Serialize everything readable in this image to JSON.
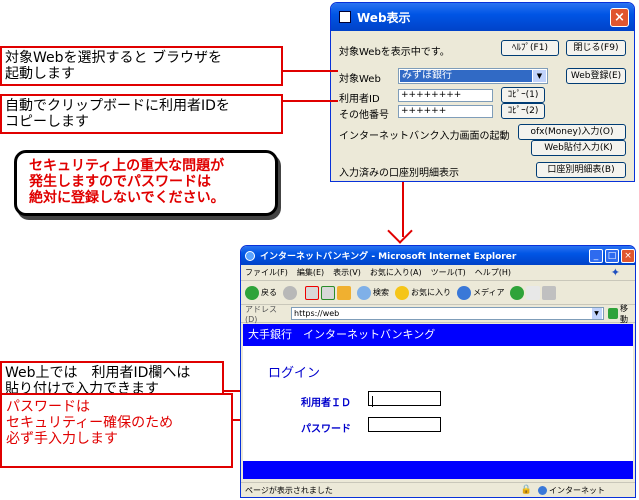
{
  "dialog": {
    "title": "Web表示",
    "close": "×",
    "status_text": "対象Webを表示中です。",
    "help_btn": "ﾍﾙﾌﾟ(F1)",
    "close_btn": "閉じる(F9)",
    "target_label": "対象Web",
    "target_value": "みずほ銀行",
    "web_register_btn": "Web登録(E)",
    "user_id_label": "利用者ID",
    "user_id_value": "++++++++",
    "copy_btn_1": "ｺﾋﾟｰ(1)",
    "other_label": "その他番号",
    "other_value": "++++++",
    "copy_btn_2": "ｺﾋﾟｰ(2)",
    "ib_label": "インターネットバンク入力画面の起動",
    "ofx_btn": "ofx(Money)入力(O)",
    "web_paste_btn": "Web貼付入力(K)",
    "statement_label": "入力済みの口座別明細表示",
    "statement_btn": "口座別明細表(B)"
  },
  "annotations": {
    "select_web": [
      "対象Webを選択すると ブラウザを",
      "起動します"
    ],
    "copy_id": [
      "自動でクリップボードに利用者IDを",
      "コピーします"
    ],
    "warning": [
      "セキュリティ上の重大な問題が",
      "発生しますのでパスワードは",
      "絶対に登録しないでください。"
    ],
    "paste_on_web": [
      "Web上では　利用者ID欄へは",
      "貼り付けで入力できます"
    ],
    "password_manual": [
      "パスワードは",
      "セキュリティー確保のため",
      "必ず手入力します"
    ]
  },
  "browser": {
    "title": "インターネットバンキング - Microsoft Internet Explorer",
    "menu": [
      "ファイル(F)",
      "編集(E)",
      "表示(V)",
      "お気に入り(A)",
      "ツール(T)",
      "ヘルプ(H)"
    ],
    "toolbar": {
      "back": "戻る",
      "search": "検索",
      "favorites": "お気に入り",
      "media": "メディア"
    },
    "address_label": "アドレス(D)",
    "address_value": "https://web",
    "go_label": "移動",
    "page_header": "大手銀行　インターネットバンキング",
    "login_title": "ログイン",
    "user_id_field_label": "利用者ＩＤ",
    "password_field_label": "パスワード",
    "status_text": "ページが表示されました",
    "zone_text": "インターネット"
  }
}
